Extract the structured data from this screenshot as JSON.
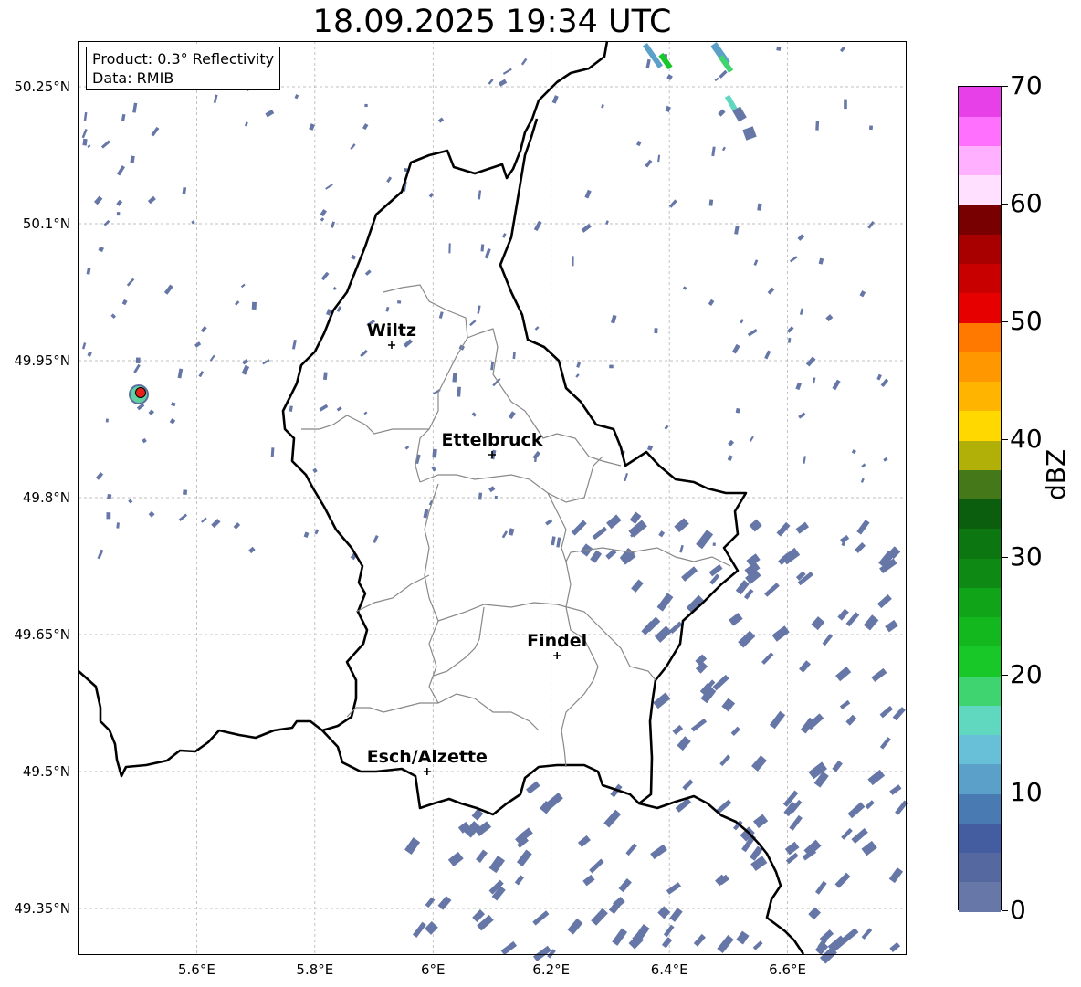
{
  "title": "18.09.2025 19:34 UTC",
  "info": {
    "product": "Product: 0.3° Reflectivity",
    "data_source": "Data: RMIB"
  },
  "map": {
    "extent_lon": [
      5.4,
      6.8
    ],
    "extent_lat": [
      49.3,
      50.3
    ],
    "lon_ticks": [
      "5.6°E",
      "5.8°E",
      "6°E",
      "6.2°E",
      "6.4°E",
      "6.6°E"
    ],
    "lat_ticks": [
      "50.25°N",
      "50.1°N",
      "49.95°N",
      "49.8°N",
      "49.65°N",
      "49.5°N",
      "49.35°N"
    ],
    "gridlines": true,
    "radar_site_color": "#e8201a",
    "cities": [
      {
        "name": "Wiltz",
        "lon": 5.93,
        "lat": 49.967
      },
      {
        "name": "Ettelbruck",
        "lon": 6.1,
        "lat": 49.847
      },
      {
        "name": "Findel",
        "lon": 6.21,
        "lat": 49.627
      },
      {
        "name": "Esch/Alzette",
        "lon": 5.99,
        "lat": 49.5
      }
    ],
    "echo_color_main": "#6677a7"
  },
  "colorbar": {
    "label": "dBZ",
    "ticks": [
      "0",
      "10",
      "20",
      "30",
      "40",
      "50",
      "60",
      "70"
    ],
    "min": 0,
    "max": 70,
    "step": 2.5,
    "colors": [
      "#6677a8",
      "#5568a0",
      "#435da0",
      "#4a7ab2",
      "#5ba0c8",
      "#68c0d8",
      "#60d8c0",
      "#40d470",
      "#18c828",
      "#12b81e",
      "#10a418",
      "#0e8a14",
      "#0c7610",
      "#0a5e0e",
      "#447818",
      "#b0b008",
      "#ffd800",
      "#ffb400",
      "#ff9800",
      "#ff7800",
      "#e60000",
      "#c80000",
      "#a80000",
      "#780000",
      "#ffe0ff",
      "#ffb0ff",
      "#ff70ff",
      "#e840e8"
    ]
  }
}
